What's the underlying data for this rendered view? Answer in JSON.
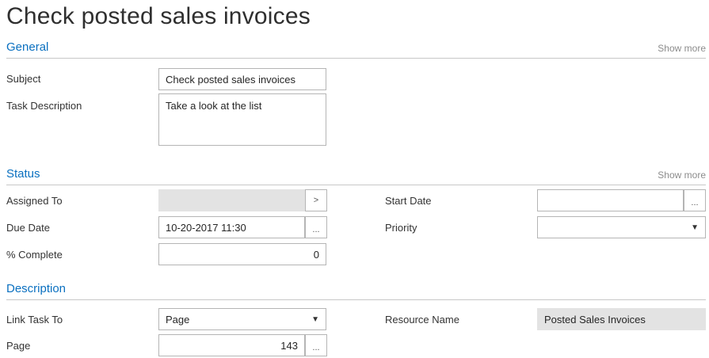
{
  "page": {
    "title": "Check posted sales invoices"
  },
  "general": {
    "title": "General",
    "show_more": "Show more",
    "subject_label": "Subject",
    "subject_value": "Check posted sales invoices",
    "task_description_label": "Task Description",
    "task_description_value": "Take a look at the list"
  },
  "status": {
    "title": "Status",
    "show_more": "Show more",
    "assigned_to_label": "Assigned To",
    "assigned_to_value": "",
    "assigned_to_button": ">",
    "due_date_label": "Due Date",
    "due_date_value": "10-20-2017 11:30",
    "due_date_button": "...",
    "percent_complete_label": "% Complete",
    "percent_complete_value": "0",
    "start_date_label": "Start Date",
    "start_date_value": "",
    "start_date_button": "...",
    "priority_label": "Priority",
    "priority_value": ""
  },
  "description": {
    "title": "Description",
    "link_task_to_label": "Link Task To",
    "link_task_to_value": "Page",
    "page_label": "Page",
    "page_value": "143",
    "page_button": "...",
    "resource_name_label": "Resource Name",
    "resource_name_value": "Posted Sales Invoices"
  },
  "icons": {
    "dropdown": "▼"
  }
}
